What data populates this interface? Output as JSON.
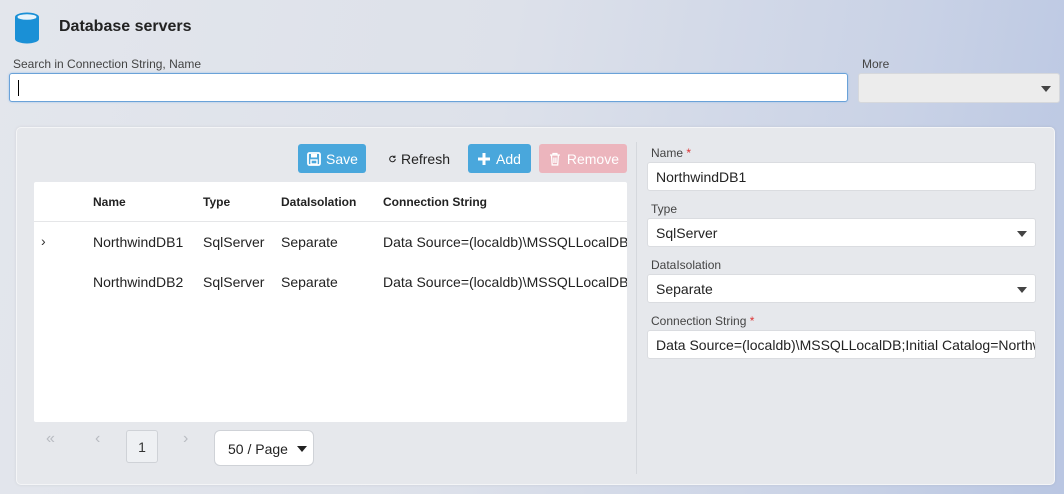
{
  "header": {
    "title": "Database servers",
    "icon": "database-icon"
  },
  "search": {
    "label": "Search in Connection String, Name",
    "value": ""
  },
  "more": {
    "label": "More",
    "value": ""
  },
  "toolbar": {
    "save_label": "Save",
    "refresh_label": "Refresh",
    "add_label": "Add",
    "remove_label": "Remove"
  },
  "grid": {
    "columns": [
      "Name",
      "Type",
      "DataIsolation",
      "Connection String"
    ],
    "rows": [
      {
        "name": "NorthwindDB1",
        "type": "SqlServer",
        "isolation": "Separate",
        "conn": "Data Source=(localdb)\\MSSQLLocalDB;"
      },
      {
        "name": "NorthwindDB2",
        "type": "SqlServer",
        "isolation": "Separate",
        "conn": "Data Source=(localdb)\\MSSQLLocalDB;"
      }
    ]
  },
  "pagination": {
    "current_page": "1",
    "page_size": "50 / Page"
  },
  "form": {
    "name_label": "Name",
    "name_value": "NorthwindDB1",
    "type_label": "Type",
    "type_value": "SqlServer",
    "isolation_label": "DataIsolation",
    "isolation_value": "Separate",
    "conn_label": "Connection String",
    "conn_value": "Data Source=(localdb)\\MSSQLLocalDB;Initial Catalog=Northw",
    "required_mark": "*"
  },
  "colors": {
    "accent": "#49a7dc",
    "remove_disabled": "#ecb5bd",
    "required": "#dd3333"
  }
}
